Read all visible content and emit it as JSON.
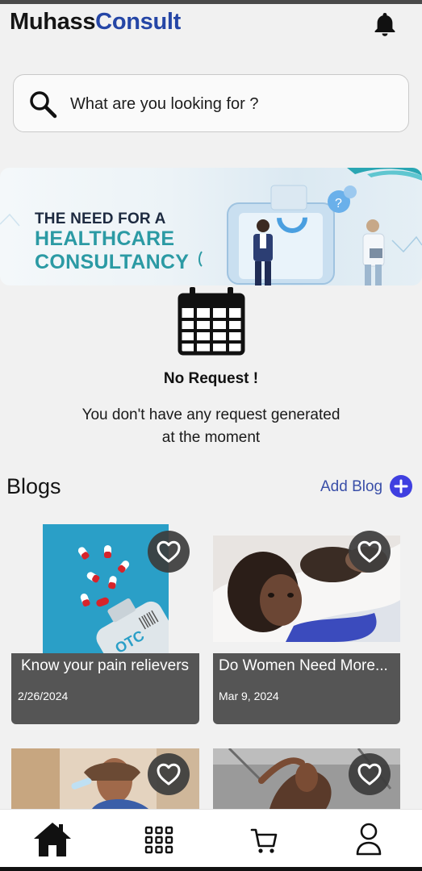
{
  "header": {
    "brand_part1": "Muhass",
    "brand_part2": "Consult",
    "notification_icon": "bell-icon"
  },
  "search": {
    "placeholder": "What are you looking for ?",
    "icon": "search-icon"
  },
  "banner": {
    "line1": "THE NEED FOR A",
    "line2": "HEALTHCARE",
    "line3": "CONSULTANCY"
  },
  "empty_state": {
    "icon": "calendar-icon",
    "title": "No Request !",
    "message_line1": "You don't have any request generated",
    "message_line2": "at the moment"
  },
  "blogs": {
    "title": "Blogs",
    "add_label": "Add Blog",
    "items": [
      {
        "title": "Know your pain relievers",
        "date": "2/26/2024"
      },
      {
        "title": "Do Women Need More...",
        "date": "Mar 9, 2024"
      },
      {
        "title": "",
        "date": ""
      },
      {
        "title": "",
        "date": ""
      }
    ]
  },
  "bottom_nav": {
    "items": [
      {
        "icon": "home-icon",
        "active": true
      },
      {
        "icon": "grid-icon",
        "active": false
      },
      {
        "icon": "cart-icon",
        "active": false
      },
      {
        "icon": "profile-icon",
        "active": false
      }
    ]
  },
  "colors": {
    "brand_dark": "#151515",
    "brand_accent": "#2546a6",
    "add_blog_button": "#3f3fe0",
    "card_info_bg": "#555555",
    "banner_teal": "#2b9aa4"
  }
}
